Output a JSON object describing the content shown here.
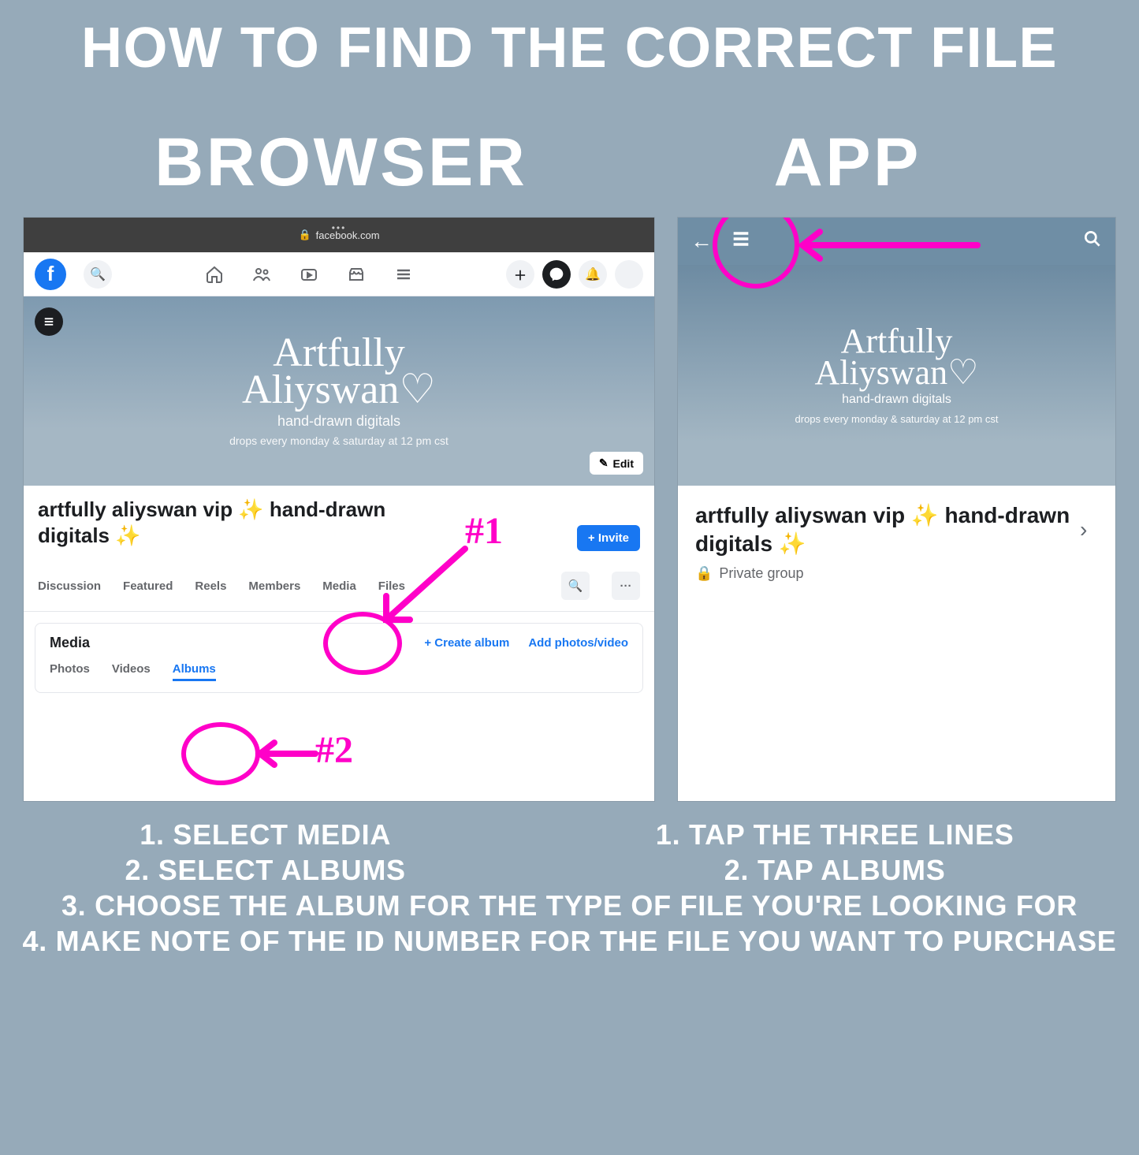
{
  "headline": "HOW TO FIND THE CORRECT FILE",
  "col_labels": {
    "left": "BROWSER",
    "right": "APP"
  },
  "browser": {
    "url": "facebook.com",
    "brand_line1": "Artfully",
    "brand_line2": "Aliyswan",
    "cover_sub": "hand-drawn digitals",
    "cover_sub2": "drops every monday & saturday at 12 pm cst",
    "edit": "Edit",
    "group_title": "artfully aliyswan vip ✨ hand-drawn digitals ✨",
    "invite": "+ Invite",
    "tabs": [
      "Discussion",
      "Featured",
      "Reels",
      "Members",
      "Media",
      "Files"
    ],
    "media_heading": "Media",
    "media_links": {
      "create": "+  Create album",
      "add": "Add photos/video"
    },
    "subtabs": [
      "Photos",
      "Videos",
      "Albums"
    ],
    "anno1": "#1",
    "anno2": "#2"
  },
  "app": {
    "brand_line1": "Artfully",
    "brand_line2": "Aliyswan",
    "cover_sub": "hand-drawn digitals",
    "cover_sub2": "drops every monday & saturday at 12 pm cst",
    "title": "artfully aliyswan vip ✨ hand-drawn digitals ✨",
    "private": "Private group"
  },
  "instructions": {
    "browser": [
      "1. SELECT MEDIA",
      "2. SELECT ALBUMS"
    ],
    "app": [
      "1. TAP THE THREE LINES",
      "2. TAP ALBUMS"
    ],
    "shared": [
      "3. CHOOSE THE ALBUM FOR THE TYPE OF FILE YOU'RE LOOKING FOR",
      "4. MAKE NOTE OF THE ID NUMBER FOR THE FILE YOU WANT TO PURCHASE"
    ]
  }
}
